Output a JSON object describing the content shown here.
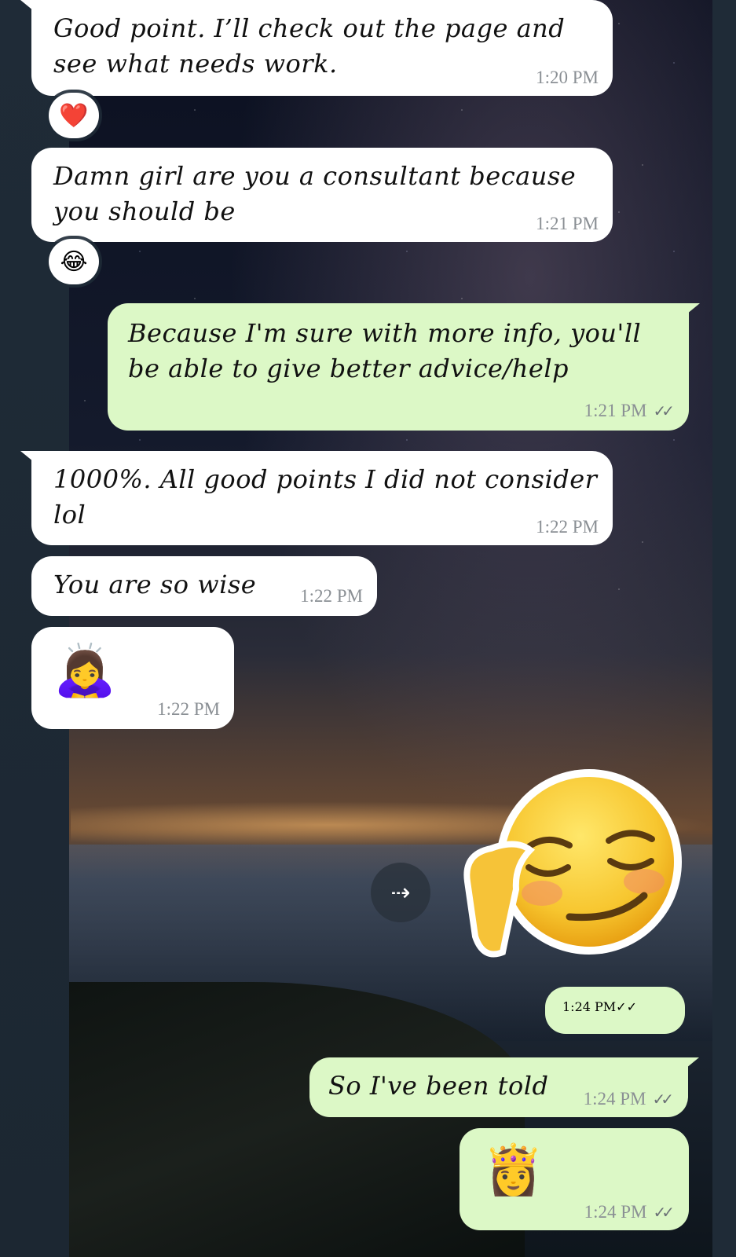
{
  "messages": [
    {
      "text_lines": [
        "Good point. I’ll check out the page and",
        "see what needs work."
      ],
      "time": "1:20 PM"
    },
    {
      "reaction": "❤️"
    },
    {
      "text_lines": [
        "Damn girl are you a consultant because",
        "you should be"
      ],
      "time": "1:21 PM"
    },
    {
      "reaction": "😂"
    },
    {
      "text_lines": [
        "Because I'm sure with more info, you'll",
        "be able to give better advice/help"
      ],
      "time": "1:21 PM",
      "ticks": "✓✓"
    },
    {
      "text_lines": [
        "1000%. All good points I did not consider",
        "lol"
      ],
      "time": "1:22 PM"
    },
    {
      "text_lines": [
        "You are so wise"
      ],
      "time": "1:22 PM"
    },
    {
      "emoji": "🙇‍♀️",
      "time": "1:22 PM"
    },
    {
      "sticker": "relieved-face-sticker",
      "time": "1:24 PM",
      "ticks": "✓✓"
    },
    {
      "text_lines": [
        "So I've been told"
      ],
      "time": "1:24 PM",
      "ticks": "✓✓"
    },
    {
      "emoji": "👸",
      "time": "1:24 PM",
      "ticks": "✓✓"
    }
  ],
  "forward_icon": "forward-icon",
  "colors": {
    "incoming_bubble": "#ffffff",
    "outgoing_bubble": "#dcf8c6",
    "timestamp": "#8a8f94"
  }
}
